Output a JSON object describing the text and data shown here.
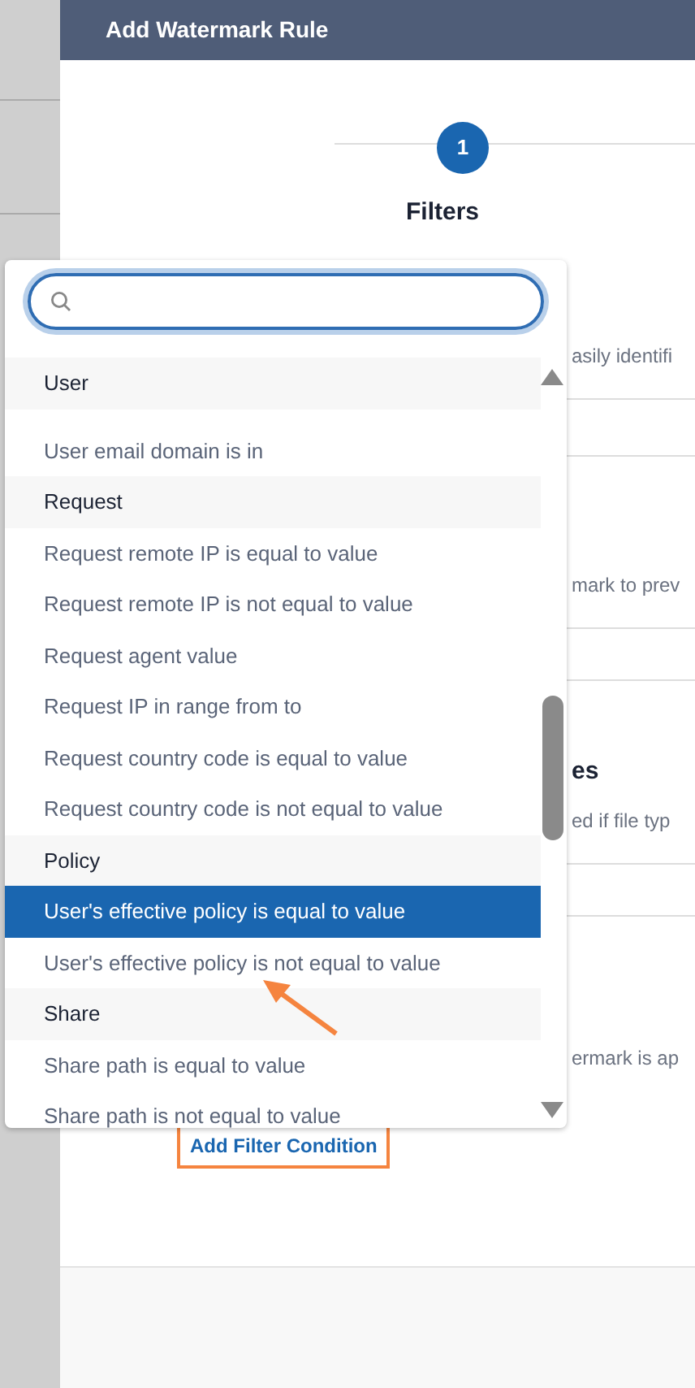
{
  "header": {
    "title": "Add Watermark Rule"
  },
  "stepper": [
    {
      "number": "1",
      "label": "Filters",
      "selected": true
    }
  ],
  "covered_texts": [
    {
      "kind": "desc",
      "text": "asily identifi"
    },
    {
      "kind": "desc",
      "text": "mark to prev"
    },
    {
      "kind": "title",
      "text": "es"
    },
    {
      "kind": "desc",
      "text": "ed if file typ"
    },
    {
      "kind": "desc",
      "text": "ermark is ap"
    }
  ],
  "dropdown": {
    "options": [
      {
        "kind": "group",
        "label": "User"
      },
      {
        "kind": "option",
        "label": "User email domain is in",
        "selected": false
      },
      {
        "kind": "group",
        "label": "Request"
      },
      {
        "kind": "option",
        "label": "Request remote IP is equal to value",
        "selected": false
      },
      {
        "kind": "option",
        "label": "Request remote IP is not equal to value",
        "selected": false
      },
      {
        "kind": "option",
        "label": "Request agent value",
        "selected": false
      },
      {
        "kind": "option",
        "label": "Request IP in range from to",
        "selected": false
      },
      {
        "kind": "option",
        "label": "Request country code is equal to value",
        "selected": false
      },
      {
        "kind": "option",
        "label": "Request country code is not equal to value",
        "selected": false
      },
      {
        "kind": "group",
        "label": "Policy"
      },
      {
        "kind": "option",
        "label": "User's effective policy is equal to value",
        "selected": true
      },
      {
        "kind": "option",
        "label": "User's effective policy is not equal to value",
        "selected": false
      },
      {
        "kind": "group",
        "label": "Share"
      },
      {
        "kind": "option",
        "label": "Share path is equal to value",
        "selected": false
      },
      {
        "kind": "option",
        "label": "Share path is not equal to value",
        "selected": false
      }
    ]
  },
  "add_button": "Add Filter Condition"
}
